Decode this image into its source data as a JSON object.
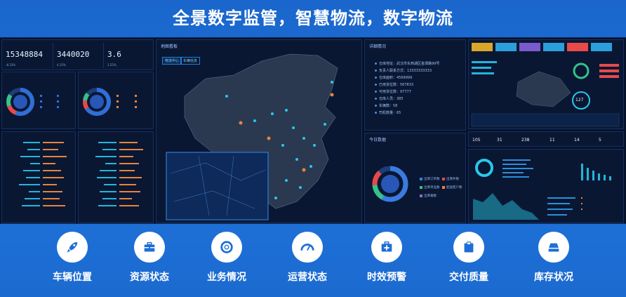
{
  "header": {
    "title": "全景数字监管，智慧物流，数字物流"
  },
  "kpis": [
    {
      "value": "15348884",
      "change": "-8.33%"
    },
    {
      "value": "3440020",
      "change": "4.15%"
    },
    {
      "value": "3.6",
      "change": "3.25%"
    }
  ],
  "map": {
    "title": "地图看板",
    "tabs": [
      "物流中心",
      "车辆信息"
    ]
  },
  "detail": {
    "title": "详细情况",
    "rows": [
      "仓库地址：武汉市东西湖区金潭路99号",
      "负责人联系方式：13333333333",
      "仓库面积：4569999",
      "已用货位数：567833",
      "可用货位数：97777",
      "仓库人员：385",
      "车辆数：58",
      "司机数量：65"
    ]
  },
  "today": {
    "title": "今日数据",
    "legend": [
      "出库订单数",
      "出库件数",
      "出库单品数",
      "配送客户数",
      "出库箱数"
    ]
  },
  "bottom_items": [
    {
      "label": "车辆位置",
      "icon": "rocket-icon"
    },
    {
      "label": "资源状态",
      "icon": "toolbox-icon"
    },
    {
      "label": "业务情况",
      "icon": "lifebuoy-icon"
    },
    {
      "label": "运营状态",
      "icon": "gauge-icon"
    },
    {
      "label": "时效预警",
      "icon": "first-aid-icon"
    },
    {
      "label": "交付质量",
      "icon": "clipboard-icon"
    },
    {
      "label": "库存状况",
      "icon": "inbox-icon"
    }
  ],
  "mini_kpis": [
    "105",
    "31",
    "238",
    "11",
    "14",
    "5"
  ],
  "gauge_value": "127",
  "colors": {
    "accent": "#23b6d9",
    "orange": "#e8843a",
    "background": "#1d6fd6",
    "panel": "#0a1733"
  }
}
